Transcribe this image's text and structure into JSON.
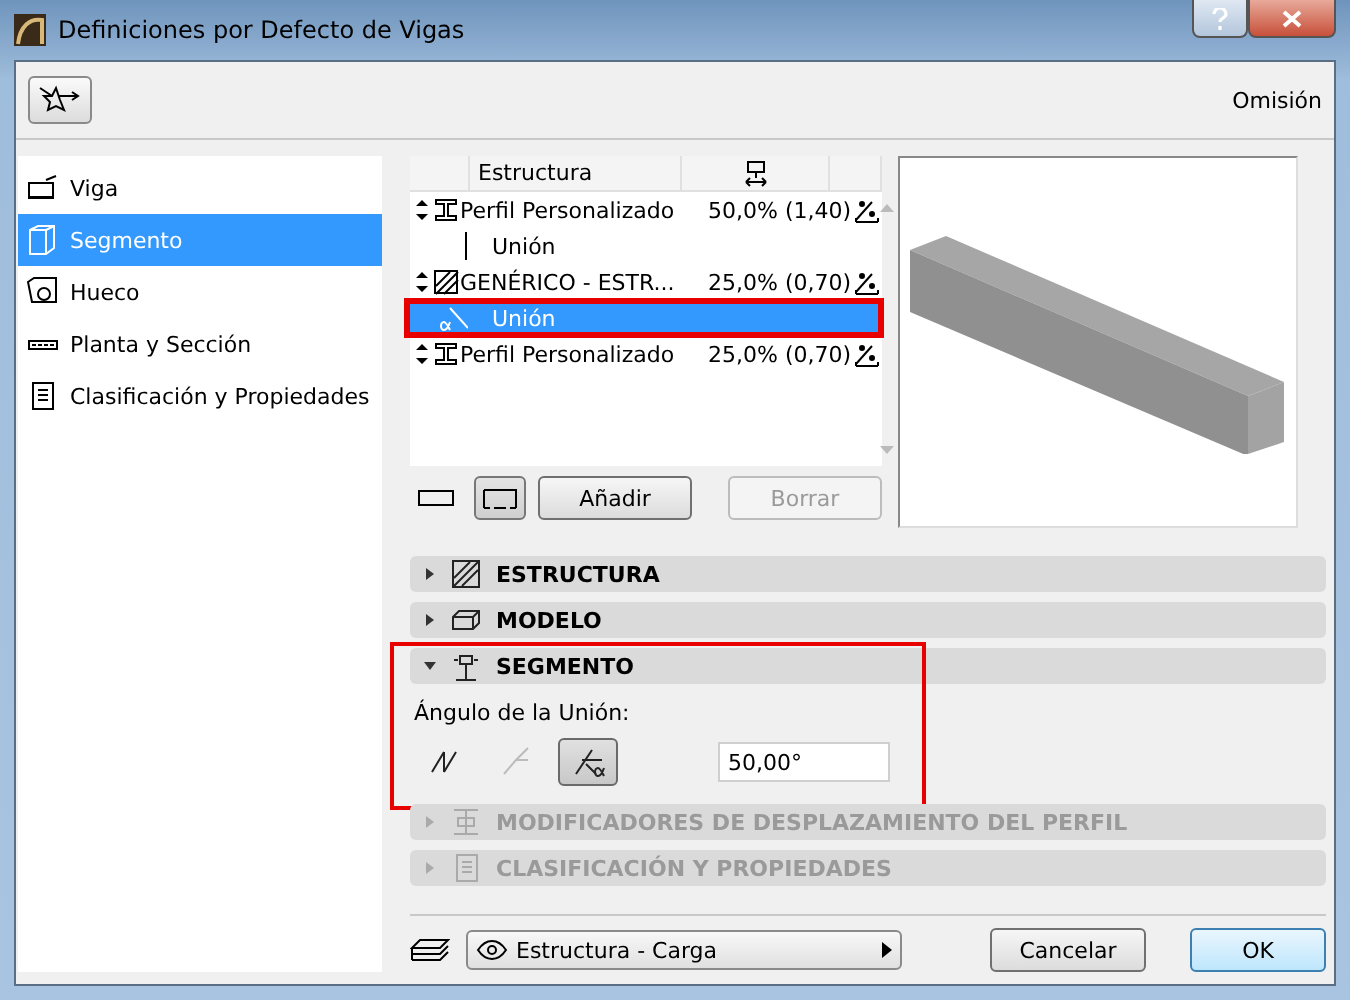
{
  "window": {
    "title": "Definiciones por Defecto de Vigas"
  },
  "toolbar": {
    "label": "Omisión"
  },
  "sidebar": {
    "items": [
      {
        "label": "Viga",
        "selected": false
      },
      {
        "label": "Segmento",
        "selected": true
      },
      {
        "label": "Hueco",
        "selected": false
      },
      {
        "label": "Planta y Sección",
        "selected": false
      },
      {
        "label": "Clasificación y Propiedades",
        "selected": false
      }
    ]
  },
  "segment_list": {
    "columns": [
      "Estructura"
    ],
    "rows": [
      {
        "kind": "profile",
        "name": "Perfil Personalizado",
        "share": "50,0% (1,40)",
        "selected": false,
        "outlined": false
      },
      {
        "kind": "joint",
        "name": "Unión",
        "selected": false,
        "outlined": false
      },
      {
        "kind": "generic",
        "name": "GENÉRICO - ESTR...",
        "share": "25,0% (0,70)",
        "selected": false,
        "outlined": false
      },
      {
        "kind": "joint",
        "name": "Unión",
        "selected": true,
        "outlined": true
      },
      {
        "kind": "profile",
        "name": "Perfil Personalizado",
        "share": "25,0% (0,70)",
        "selected": false,
        "outlined": false
      }
    ],
    "view_toggles": [
      {
        "selected": false
      },
      {
        "selected": true
      }
    ],
    "buttons": [
      {
        "label": "Añadir",
        "disabled": false
      },
      {
        "label": "Borrar",
        "disabled": true
      }
    ]
  },
  "sections": [
    {
      "title": "ESTRUCTURA",
      "expanded": false,
      "disabled": false,
      "outlined": false
    },
    {
      "title": "MODELO",
      "expanded": false,
      "disabled": false,
      "outlined": false
    },
    {
      "title": "SEGMENTO",
      "expanded": true,
      "disabled": false,
      "outlined": true
    },
    {
      "title": "MODIFICADORES DE DESPLAZAMIENTO DEL PERFIL",
      "expanded": false,
      "disabled": true,
      "outlined": false
    },
    {
      "title": "CLASIFICACIÓN Y PROPIEDADES",
      "expanded": false,
      "disabled": true,
      "outlined": false
    }
  ],
  "segment_panel": {
    "label": "Ángulo de la Unión:",
    "options": [
      {
        "selected": false,
        "disabled": false
      },
      {
        "selected": false,
        "disabled": true
      },
      {
        "selected": true,
        "disabled": false
      }
    ],
    "angle": "50,00°"
  },
  "footer": {
    "layer": "Estructura - Carga",
    "buttons": [
      {
        "label": "Cancelar",
        "default": false
      },
      {
        "label": "OK",
        "default": true
      }
    ]
  }
}
